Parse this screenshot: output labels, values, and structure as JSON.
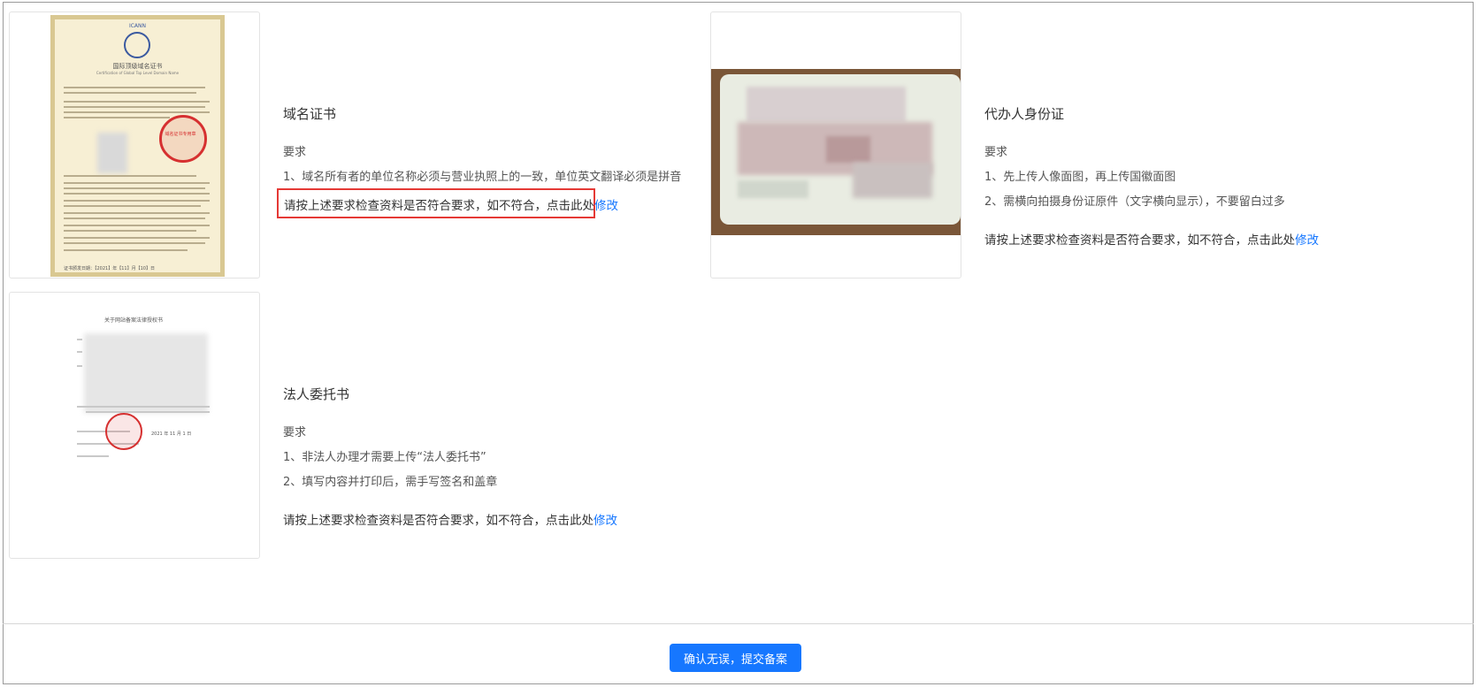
{
  "sections": [
    {
      "title": "域名证书",
      "req_label": "要求",
      "lines": [
        "1、域名所有者的单位名称必须与营业执照上的一致，单位英文翻译必须是拼音"
      ],
      "check_text": "请按上述要求检查资料是否符合要求，如不符合，点击此处",
      "edit_link": "修改"
    },
    {
      "title": "代办人身份证",
      "req_label": "要求",
      "lines": [
        "1、先上传人像面图，再上传国徽面图",
        "2、需横向拍摄身份证原件（文字横向显示），不要留白过多"
      ],
      "check_text": "请按上述要求检查资料是否符合要求，如不符合，点击此处",
      "edit_link": "修改"
    },
    {
      "title": "法人委托书",
      "req_label": "要求",
      "lines": [
        "1、非法人办理才需要上传“法人委托书”",
        "2、填写内容并打印后，需手写签名和盖章"
      ],
      "check_text": "请按上述要求检查资料是否符合要求，如不符合，点击此处",
      "edit_link": "修改"
    }
  ],
  "submit_label": "确认无误，提交备案",
  "cert_image": {
    "header": "ICANN",
    "title_cn": "国际顶级域名证书",
    "title_en": "Certification of Global Top Level Domain Name",
    "seal_text": "域名证书专用章",
    "date": "证书颁发日期：【2021】年【11】月【10】日"
  },
  "auth_doc": {
    "title": "关于网站备案法律授权书",
    "date": "2021 年 11 月 1 日"
  },
  "colors": {
    "accent": "#1677ff",
    "highlight": "#e53935",
    "seal": "#d63030"
  }
}
